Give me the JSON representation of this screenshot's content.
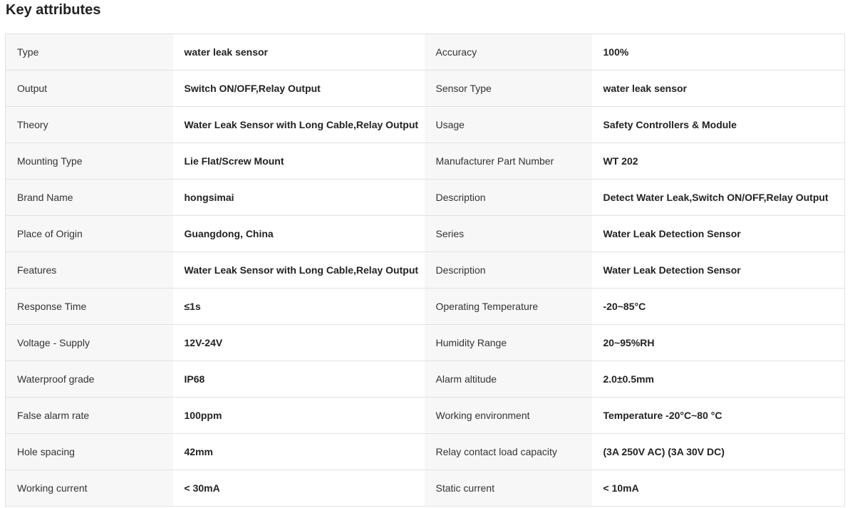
{
  "section": {
    "title": "Key attributes"
  },
  "rows": [
    {
      "k1": "Type",
      "v1": "water leak sensor",
      "k2": "Accuracy",
      "v2": "100%"
    },
    {
      "k1": "Output",
      "v1": "Switch ON/OFF,Relay Output",
      "k2": "Sensor Type",
      "v2": "water leak sensor"
    },
    {
      "k1": "Theory",
      "v1": "Water Leak Sensor with Long Cable,Relay Output",
      "k2": "Usage",
      "v2": "Safety Controllers & Module"
    },
    {
      "k1": "Mounting Type",
      "v1": "Lie Flat/Screw Mount",
      "k2": "Manufacturer Part Number",
      "v2": "WT 202"
    },
    {
      "k1": "Brand Name",
      "v1": "hongsimai",
      "k2": "Description",
      "v2": "Detect Water Leak,Switch ON/OFF,Relay Output"
    },
    {
      "k1": "Place of Origin",
      "v1": "Guangdong, China",
      "k2": "Series",
      "v2": "Water Leak Detection Sensor"
    },
    {
      "k1": "Features",
      "v1": "Water Leak Sensor with Long Cable,Relay Output",
      "k2": "Description",
      "v2": "Water Leak Detection Sensor"
    },
    {
      "k1": "Response Time",
      "v1": "≤1s",
      "k2": "Operating Temperature",
      "v2": "-20~85°C"
    },
    {
      "k1": "Voltage - Supply",
      "v1": "12V-24V",
      "k2": "Humidity Range",
      "v2": "20~95%RH"
    },
    {
      "k1": "Waterproof grade",
      "v1": "IP68",
      "k2": "Alarm altitude",
      "v2": "2.0±0.5mm"
    },
    {
      "k1": "False alarm rate",
      "v1": "100ppm",
      "k2": "Working environment",
      "v2": "Temperature -20°C~80 °C"
    },
    {
      "k1": "Hole spacing",
      "v1": "42mm",
      "k2": "Relay contact load capacity",
      "v2": "(3A 250V AC) (3A 30V DC)"
    },
    {
      "k1": "Working current",
      "v1": "< 30mA",
      "k2": "Static current",
      "v2": "< 10mA"
    }
  ]
}
